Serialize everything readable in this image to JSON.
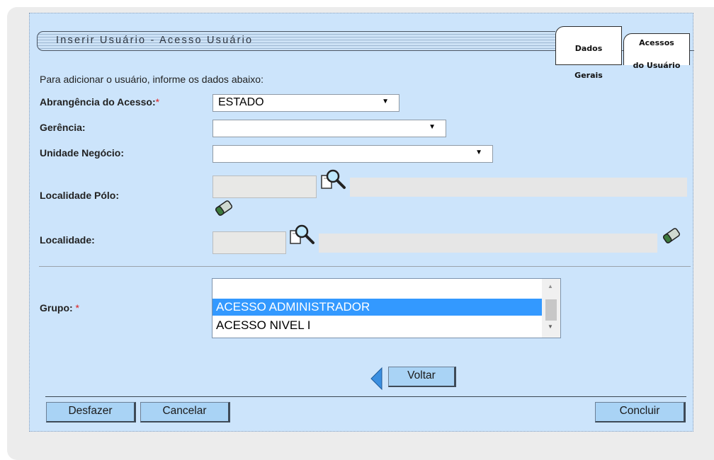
{
  "header": {
    "title": "Inserir Usuário - Acesso Usuário",
    "tabs": [
      {
        "line1": "Dados",
        "line2": "Gerais"
      },
      {
        "line1": "Acessos",
        "line2": "do Usuário"
      }
    ]
  },
  "form": {
    "intro": "Para adicionar o usuário, informe os dados abaixo:",
    "required_mark": "*",
    "abrangencia": {
      "label": "Abrangência do Acesso:",
      "value": "ESTADO"
    },
    "gerencia": {
      "label": "Gerência:",
      "value": ""
    },
    "unidade": {
      "label": "Unidade Negócio:",
      "value": ""
    },
    "localidade_polo": {
      "label": "Localidade Pólo:",
      "code": "",
      "name": ""
    },
    "localidade": {
      "label": "Localidade:",
      "code": "",
      "name": ""
    },
    "grupo": {
      "label": "Grupo:",
      "options": [
        "",
        "ACESSO ADMINISTRADOR",
        "ACESSO NIVEL I"
      ],
      "selected": "ACESSO ADMINISTRADOR"
    }
  },
  "buttons": {
    "voltar": "Voltar",
    "desfazer": "Desfazer",
    "cancelar": "Cancelar",
    "concluir": "Concluir"
  },
  "icons": [
    "search-icon",
    "eraser-icon",
    "back-arrow-icon"
  ],
  "colors": {
    "panel": "#cce4fb",
    "button": "#a9d3f5",
    "selected_option": "#3399ff",
    "required": "#e02020"
  }
}
